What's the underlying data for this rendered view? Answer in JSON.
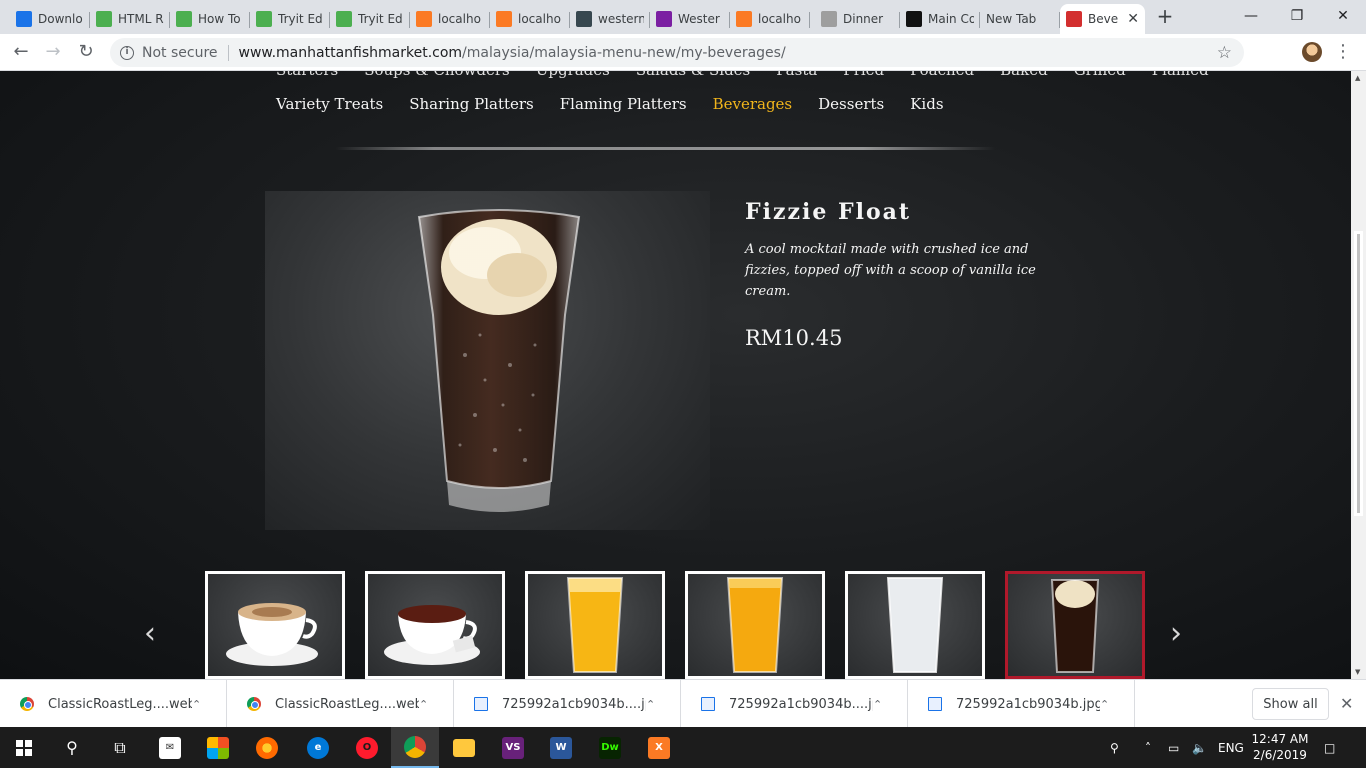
{
  "browser": {
    "tabs": [
      {
        "title": "Downlo",
        "icon": "download-icon",
        "color": "#1a73e8"
      },
      {
        "title": "HTML R",
        "icon": "w3schools-icon",
        "color": "#4caf50"
      },
      {
        "title": "How To",
        "icon": "w3schools-icon",
        "color": "#4caf50"
      },
      {
        "title": "Tryit Ed",
        "icon": "w3schools-icon",
        "color": "#4caf50"
      },
      {
        "title": "Tryit Ed",
        "icon": "w3schools-icon",
        "color": "#4caf50"
      },
      {
        "title": "localho",
        "icon": "xampp-icon",
        "color": "#fb7a24"
      },
      {
        "title": "localho",
        "icon": "xampp-icon",
        "color": "#fb7a24"
      },
      {
        "title": "western",
        "icon": "site-icon",
        "color": "#37474f"
      },
      {
        "title": "Wester",
        "icon": "play-icon",
        "color": "#7b1fa2"
      },
      {
        "title": "localho",
        "icon": "xampp-icon",
        "color": "#fb7a24"
      },
      {
        "title": "Dinner",
        "icon": "doc-icon",
        "color": "#9e9e9e"
      },
      {
        "title": "Main Co",
        "icon": "s-icon",
        "color": "#111111"
      },
      {
        "title": "New Tab",
        "icon": "",
        "color": ""
      },
      {
        "title": "Beve",
        "icon": "fish-market-icon",
        "color": "#d32f2f"
      }
    ],
    "active_tab_close": "✕",
    "new_tab_symbol": "+",
    "security_label": "Not secure",
    "url_host": "www.manhattanfishmarket.com",
    "url_path": "/malaysia/malaysia-menu-new/my-beverages/"
  },
  "page": {
    "menu_top": [
      "Starters",
      "Soups & Chowders",
      "Upgrades",
      "Salads & Sides",
      "Pasta",
      "Fried",
      "Poached",
      "Baked",
      "Grilled",
      "Flamed"
    ],
    "menu_main": [
      {
        "label": "Variety Treats",
        "active": false
      },
      {
        "label": "Sharing Platters",
        "active": false
      },
      {
        "label": "Flaming Platters",
        "active": false
      },
      {
        "label": "Beverages",
        "active": true
      },
      {
        "label": "Desserts",
        "active": false
      },
      {
        "label": "Kids",
        "active": false
      }
    ],
    "product": {
      "name": "Fizzie Float",
      "description": "A cool mocktail made with crushed ice and fizzies, topped off with a scoop of vanilla ice cream.",
      "price": "RM10.45"
    },
    "accent_color": "#f0b41c",
    "selected_border_color": "#b0192b",
    "thumbnails": [
      {
        "name": "cappuccino-thumbnail",
        "selected": false
      },
      {
        "name": "tea-thumbnail",
        "selected": false
      },
      {
        "name": "orange-drink-thumbnail",
        "selected": false
      },
      {
        "name": "orange-juice-thumbnail",
        "selected": false
      },
      {
        "name": "milky-drink-thumbnail",
        "selected": false
      },
      {
        "name": "fizzie-float-thumbnail",
        "selected": true
      }
    ],
    "prev_arrow": "‹",
    "next_arrow": "›"
  },
  "downloads": {
    "items": [
      {
        "name": "ClassicRoastLeg....webp",
        "icon": "chrome"
      },
      {
        "name": "ClassicRoastLeg....webp",
        "icon": "chrome"
      },
      {
        "name": "725992a1cb9034b....jpg",
        "icon": "img"
      },
      {
        "name": "725992a1cb9034b....jpg",
        "icon": "img"
      },
      {
        "name": "725992a1cb9034b.jpg",
        "icon": "img"
      }
    ],
    "show_all_label": "Show all"
  },
  "taskbar": {
    "language": "ENG",
    "time": "12:47 AM",
    "date": "2/6/2019"
  }
}
